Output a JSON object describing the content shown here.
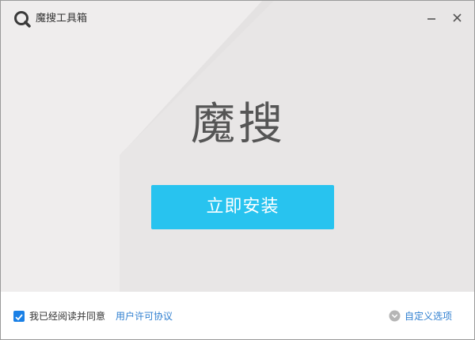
{
  "window": {
    "title": "魔搜工具箱",
    "minimize_icon": "minimize-icon",
    "close_icon": "close-icon"
  },
  "hero": {
    "brand_text": "魔搜"
  },
  "install_button": {
    "label": "立即安装",
    "color": "#28c3ef"
  },
  "footer": {
    "agree_checked": true,
    "agree_text": "我已经阅读并同意",
    "license_link": "用户许可协议",
    "custom_options": "自定义选项",
    "link_color": "#2f7fd0",
    "checkbox_color": "#1a80e6"
  }
}
